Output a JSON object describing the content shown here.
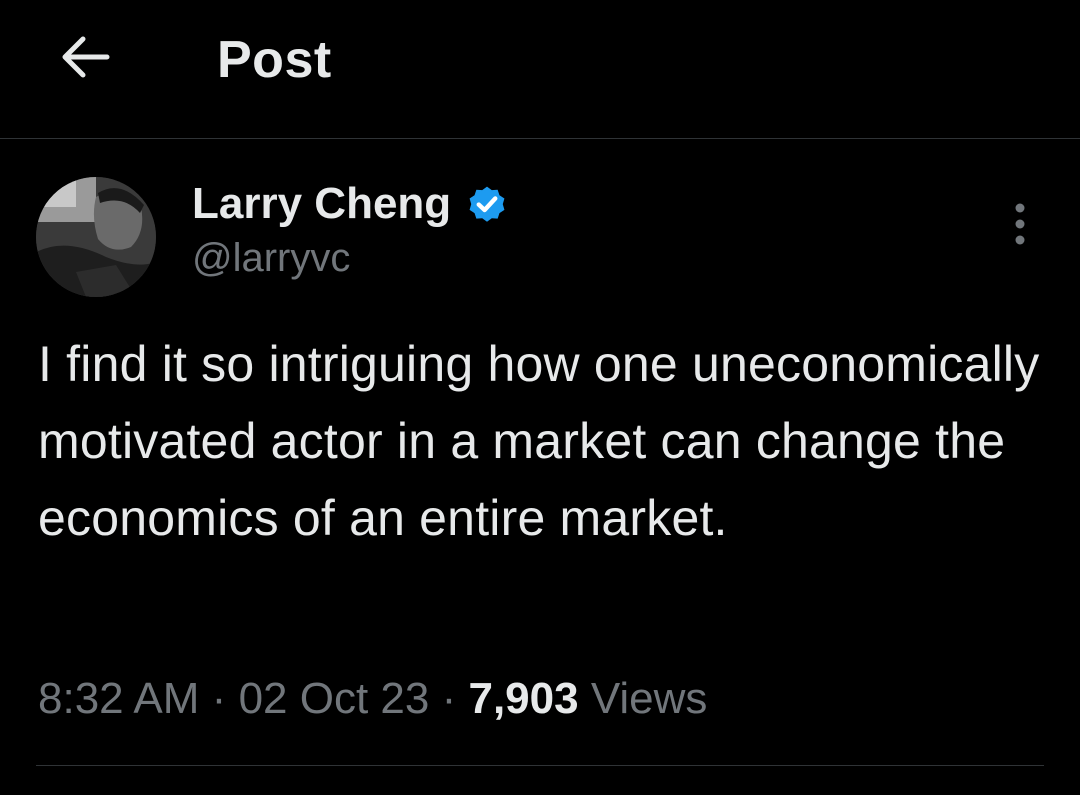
{
  "header": {
    "back_icon": "arrow-left-icon",
    "title": "Post"
  },
  "post": {
    "author": {
      "display_name": "Larry Cheng",
      "handle": "@larryvc",
      "verified": true,
      "verified_color": "#1d9bf0",
      "avatar_icon": "user-avatar"
    },
    "more_icon": "more-vertical-icon",
    "text": "I find it so intriguing how one uneconomically motivated actor in a market can change the economics of an entire market.",
    "time": "8:32 AM",
    "separator": "·",
    "date": "02 Oct 23",
    "views_count": "7,903",
    "views_label": "Views"
  },
  "colors": {
    "background": "#000000",
    "primary_text": "#e7e9ea",
    "secondary_text": "#71767b",
    "divider": "#2f3336",
    "accent": "#1d9bf0"
  }
}
